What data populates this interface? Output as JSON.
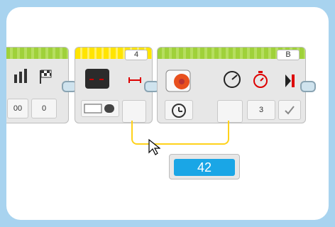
{
  "blocks": {
    "left": {
      "values": [
        "00",
        "0"
      ]
    },
    "sensor": {
      "port": "4"
    },
    "motor": {
      "port": "B",
      "value": "3"
    }
  },
  "display": {
    "value": "42"
  },
  "icons": [
    "bars-icon",
    "flag-icon",
    "distance-sensor-icon",
    "range-arrows-icon",
    "ruler-icon",
    "motor-icon",
    "speed-gauge-icon",
    "timer-icon",
    "stop-bar-icon",
    "rotation-icon",
    "check-icon",
    "mouse-cursor-icon"
  ],
  "colors": {
    "accent_blue": "#1aa6e6",
    "wire": "#ffd21a",
    "green": "#9fd13a",
    "yellow": "#ffe400"
  }
}
